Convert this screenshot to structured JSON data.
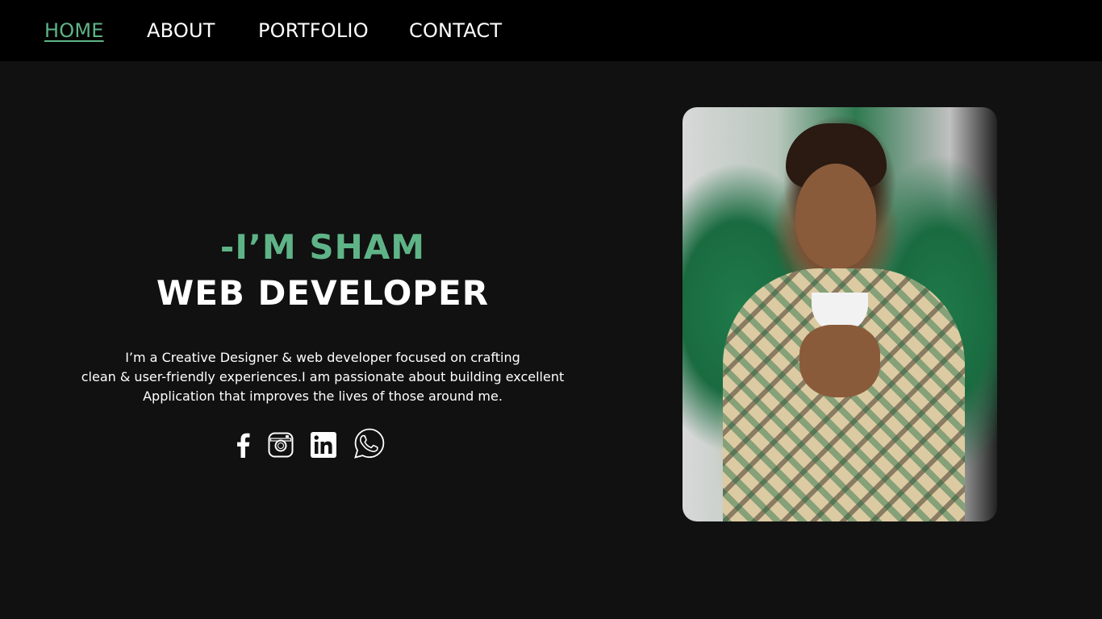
{
  "nav": {
    "items": [
      {
        "label": "HOME",
        "active": true
      },
      {
        "label": "ABOUT",
        "active": false
      },
      {
        "label": "PORTFOLIO",
        "active": false
      },
      {
        "label": "CONTACT",
        "active": false
      }
    ]
  },
  "hero": {
    "intro": "-I’M SHAM",
    "role": "WEB DEVELOPER",
    "bio_lines": [
      "I’m a Creative Designer & web developer focused on crafting",
      "clean & user-friendly experiences.I am passionate about building excellent",
      "Application that improves the lives of those around me."
    ]
  },
  "socials": [
    {
      "icon": "facebook-icon"
    },
    {
      "icon": "instagram-icon"
    },
    {
      "icon": "linkedin-icon"
    },
    {
      "icon": "whatsapp-icon"
    }
  ],
  "colors": {
    "accent": "#5fb487",
    "background": "#111111",
    "navbar": "#000000",
    "text": "#ffffff"
  }
}
